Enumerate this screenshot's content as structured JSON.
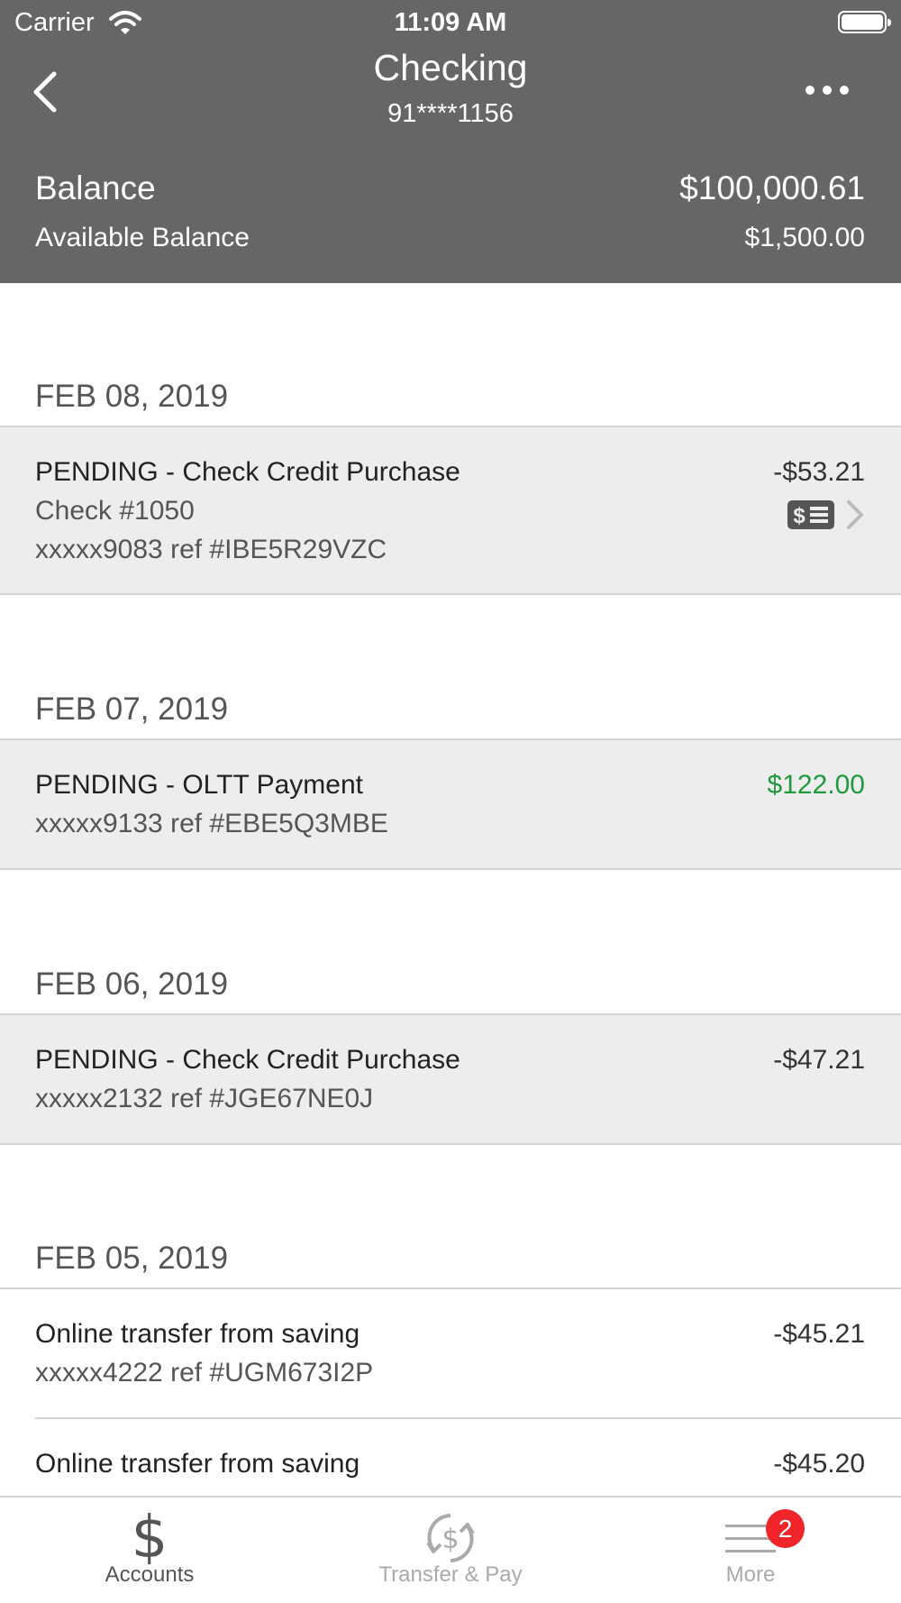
{
  "status_bar": {
    "carrier": "Carrier",
    "time": "11:09 AM"
  },
  "header": {
    "title": "Checking",
    "account_number": "91****1156",
    "balance_label": "Balance",
    "balance_value": "$100,000.61",
    "available_label": "Available Balance",
    "available_value": "$1,500.00"
  },
  "transactions": [
    {
      "date": "FEB 08, 2019",
      "items": [
        {
          "description": "PENDING - Check Credit Purchase",
          "line2": "Check #1050",
          "line3": "xxxxx9083 ref #IBE5R29VZC",
          "amount": "-$53.21",
          "pending": true,
          "has_check_image": true
        }
      ]
    },
    {
      "date": "FEB 07, 2019",
      "items": [
        {
          "description": "PENDING - OLTT Payment",
          "line2": "xxxxx9133 ref #EBE5Q3MBE",
          "amount": "$122.00",
          "pending": true
        }
      ]
    },
    {
      "date": "FEB 06, 2019",
      "items": [
        {
          "description": "PENDING - Check Credit Purchase",
          "line2": "xxxxx2132 ref #JGE67NE0J",
          "amount": "-$47.21",
          "pending": true
        }
      ]
    },
    {
      "date": "FEB 05, 2019",
      "items": [
        {
          "description": "Online transfer from saving",
          "line2": "xxxxx4222 ref #UGM673I2P",
          "amount": "-$45.21",
          "pending": false
        },
        {
          "description": "Online transfer from saving",
          "amount": "-$45.20",
          "pending": false
        }
      ]
    }
  ],
  "tab_bar": {
    "tabs": [
      {
        "label": "Accounts",
        "icon": "dollar-icon",
        "active": true
      },
      {
        "label": "Transfer & Pay",
        "icon": "transfer-pay-icon",
        "active": false
      },
      {
        "label": "More",
        "icon": "menu-icon",
        "active": false,
        "badge": "2"
      }
    ]
  },
  "colors": {
    "header_bg": "#666666",
    "pending_row_bg": "#ededed",
    "positive_amount": "#1f9a3c",
    "badge": "#f0252a"
  }
}
